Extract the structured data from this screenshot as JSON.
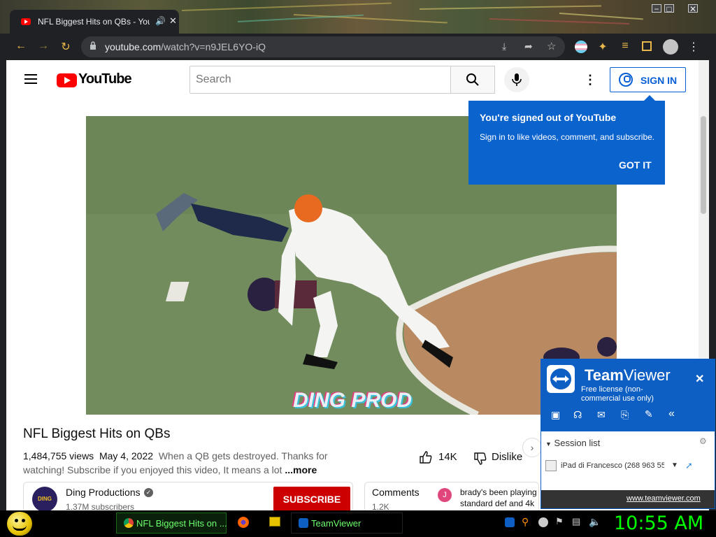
{
  "browser": {
    "tab_title": "NFL Biggest Hits on QBs - YouTube",
    "url_domain": "youtube.com",
    "url_path": "/watch?v=n9JEL6YO-iQ"
  },
  "youtube": {
    "logo_text": "YouTube",
    "search_placeholder": "Search",
    "sign_in_label": "SIGN IN",
    "popup": {
      "title": "You're signed out of YouTube",
      "body": "Sign in to like videos, comment, and subscribe.",
      "button": "GOT IT"
    },
    "video": {
      "watermark": "DING PROD",
      "title": "NFL Biggest Hits on QBs",
      "views": "1,484,755 views",
      "date": "May 4, 2022",
      "description": "When a QB gets destroyed. Thanks for watching! Subscribe if you enjoyed this video, It means a lot",
      "more": "...more",
      "likes": "14K",
      "dislike_label": "Dislike"
    },
    "channel": {
      "name": "Ding Productions",
      "subscribers": "1.37M subscribers",
      "subscribe_label": "SUBSCRIBE",
      "avatar_text": "DING"
    },
    "comments": {
      "label": "Comments",
      "count": "1.2K",
      "preview": "brady's been playing standard def and 4k",
      "avatar_letter": "J"
    }
  },
  "teamviewer": {
    "title_bold": "Team",
    "title_light": "Viewer",
    "license": "Free license (non-commercial use only)",
    "session_list_label": "Session list",
    "session_item": "iPad di Francesco (268 963 55",
    "footer_link": "www.teamviewer.com"
  },
  "taskbar": {
    "chrome_task": "NFL Biggest Hits on ...",
    "teamviewer_task": "TeamViewer",
    "clock": "10:55 AM"
  },
  "colors": {
    "youtube_red": "#ff0000",
    "youtube_blue": "#065fd4",
    "popup_blue": "#0b63ce",
    "teamviewer_blue": "#0e5fc4",
    "clock_green": "#00ff00"
  }
}
